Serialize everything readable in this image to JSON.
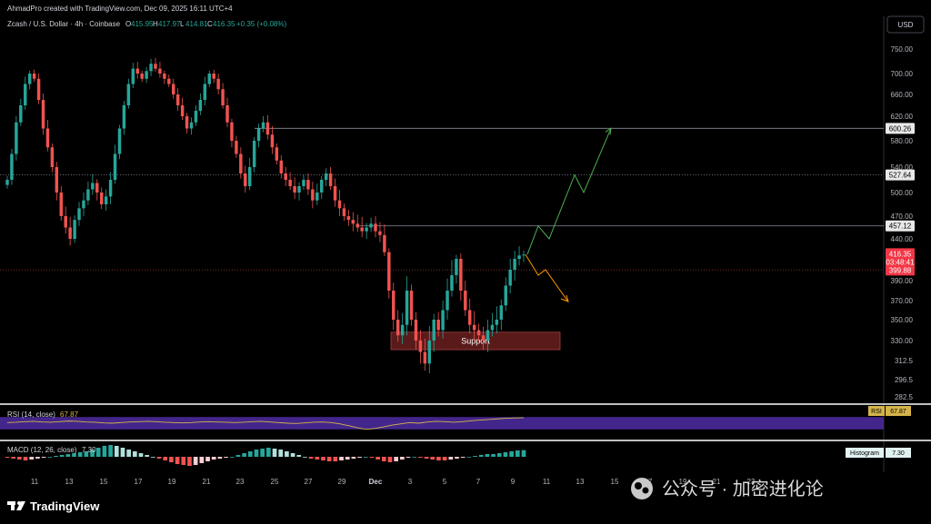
{
  "header": {
    "attribution": "AhmadPro created with TradingView.com, Dec 09, 2025 16:11 UTC+4",
    "symbol": "Zcash / U.S. Dollar · 4h · Coinbase",
    "o_label": "O",
    "o": "415.95",
    "h_label": "H",
    "h": "417.97",
    "l_label": "L",
    "l": "414.81",
    "c_label": "C",
    "c": "416.35",
    "change": "+0.35 (+0.08%)"
  },
  "currency": "USD",
  "price_tags": {
    "level_600": "600.26",
    "level_527": "527.64",
    "level_457": "457.12",
    "current_price": "416.35",
    "countdown": "03:48:41",
    "level_399": "399.88"
  },
  "support_label": "Support",
  "rsi": {
    "label": "RSI (14, close)",
    "value": "67.87",
    "tag": "RSI",
    "tag_value": "67.87"
  },
  "macd": {
    "label": "MACD (12, 26, close)",
    "value": "7.30",
    "tag": "Histogram",
    "tag_value": "7.30"
  },
  "footer": {
    "logo": "TradingView",
    "watermark": "公众号 · 加密进化论"
  },
  "colors": {
    "up": "#26a69a",
    "down": "#ef5350",
    "background": "#000000",
    "rsi_band": "#4a2a9a",
    "rsi_line": "#d4b44a",
    "support_box": "#5a1a1a",
    "green_path": "#4caf50",
    "orange_path": "#ff9800",
    "current_tag": "#f23645"
  },
  "chart_data": {
    "type": "candlestick",
    "instrument": "Zcash / U.S. Dollar",
    "timeframe": "4h",
    "y_ticks": [
      750,
      700,
      660,
      620,
      580,
      540,
      500,
      470,
      440,
      410,
      390,
      370,
      350,
      330,
      312.5,
      296.5,
      282.5
    ],
    "x_ticks": [
      "11",
      "13",
      "15",
      "17",
      "19",
      "21",
      "23",
      "25",
      "27",
      "29",
      "Dec",
      "3",
      "5",
      "7",
      "9",
      "11",
      "13",
      "15",
      "17",
      "19",
      "21",
      "23"
    ],
    "ylim": [
      275,
      800
    ],
    "horizontal_levels": [
      600.26,
      527.64,
      457.12,
      399.88
    ],
    "support_zone": [
      322,
      338
    ],
    "closes": [
      520,
      560,
      610,
      640,
      680,
      700,
      690,
      650,
      600,
      570,
      540,
      500,
      470,
      455,
      440,
      465,
      480,
      490,
      505,
      515,
      500,
      485,
      495,
      520,
      560,
      600,
      640,
      680,
      710,
      700,
      690,
      705,
      720,
      710,
      700,
      690,
      680,
      660,
      640,
      620,
      600,
      610,
      630,
      650,
      680,
      700,
      690,
      670,
      640,
      610,
      580,
      560,
      530,
      510,
      540,
      580,
      600,
      610,
      590,
      570,
      550,
      530,
      520,
      510,
      500,
      510,
      520,
      505,
      490,
      500,
      520,
      530,
      510,
      490,
      480,
      470,
      465,
      460,
      455,
      450,
      455,
      460,
      450,
      445,
      420,
      380,
      350,
      335,
      345,
      380,
      350,
      330,
      320,
      310,
      330,
      350,
      340,
      360,
      380,
      395,
      410,
      380,
      360,
      345,
      340,
      335,
      330,
      340,
      345,
      350,
      365,
      385,
      400,
      410,
      415,
      416.35
    ],
    "rsi": {
      "values": [
        52,
        53,
        55,
        56,
        54,
        53,
        55,
        57,
        56,
        54,
        53,
        51,
        50,
        52,
        54,
        55,
        56,
        55,
        53,
        52,
        51,
        52,
        54,
        55,
        54,
        53,
        52,
        53,
        55,
        56,
        54,
        52,
        50,
        49,
        51,
        53,
        54,
        52,
        48,
        42,
        35,
        30,
        33,
        38,
        44,
        48,
        52,
        50,
        54,
        56,
        55,
        53,
        55,
        58,
        60,
        62,
        64,
        66,
        67,
        67.87
      ],
      "ylim": [
        0,
        100
      ],
      "band": [
        30,
        70
      ]
    },
    "macd_histogram": [
      -1,
      -2,
      -3,
      -4,
      -3,
      -2,
      -1,
      0,
      1,
      2,
      3,
      4,
      5,
      6,
      8,
      10,
      12,
      13,
      12,
      10,
      8,
      6,
      4,
      2,
      0,
      -2,
      -4,
      -6,
      -8,
      -9,
      -10,
      -9,
      -7,
      -5,
      -3,
      -2,
      -1,
      0,
      2,
      4,
      6,
      8,
      9,
      10,
      9,
      8,
      6,
      4,
      2,
      0,
      -2,
      -3,
      -4,
      -5,
      -5,
      -4,
      -3,
      -2,
      -1,
      0,
      -1,
      -3,
      -5,
      -6,
      -5,
      -3,
      -1,
      0,
      -1,
      -2,
      -3,
      -4,
      -4,
      -3,
      -2,
      -1,
      0,
      1,
      2,
      3,
      3,
      4,
      5,
      6,
      7,
      7.3
    ],
    "projections": {
      "bullish": [
        [
          416.35
        ],
        [
          457.12
        ],
        [
          440
        ],
        [
          527.64
        ],
        [
          500
        ],
        [
          600.26
        ]
      ],
      "bearish": [
        [
          416.35
        ],
        [
          395
        ],
        [
          400
        ],
        [
          370
        ]
      ]
    }
  }
}
